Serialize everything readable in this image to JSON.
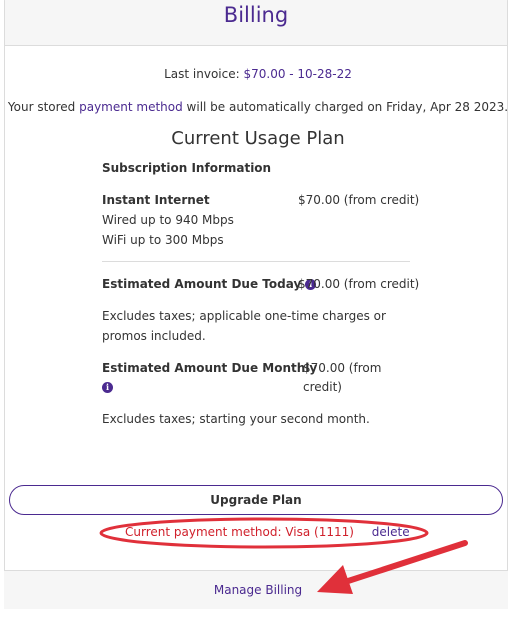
{
  "header": {
    "title": "Billing"
  },
  "invoice": {
    "label": "Last invoice: ",
    "link_text": "$70.00 - 10-28-22"
  },
  "autocharge": {
    "prefix": "Your stored ",
    "link_text": "payment method",
    "suffix": " will be automatically charged on Friday, Apr 28 2023."
  },
  "plan": {
    "title": "Current Usage Plan",
    "section_heading": "Subscription Information",
    "name": "Instant Internet",
    "price": "$70.00 (from credit)",
    "features": [
      "Wired up to 940 Mbps",
      "WiFi up to 300 Mbps"
    ],
    "today": {
      "label": "Estimated Amount Due Today",
      "price": "$70.00 (from credit)",
      "note_lines": [
        "Excludes taxes; applicable one-time charges or",
        "promos included."
      ]
    },
    "monthly": {
      "label": "Estimated Amount Due Monthly",
      "price_lines": [
        "$70.00 (from",
        "credit)"
      ],
      "note": "Excludes taxes; starting your second month."
    }
  },
  "actions": {
    "upgrade_label": "Upgrade Plan",
    "payment_method_text": "Current payment method: Visa (1111)",
    "delete_label": "delete",
    "manage_billing_label": "Manage Billing"
  },
  "icons": {
    "info": "info-icon",
    "arrow": "arrow-annotation",
    "ellipse": "ellipse-annotation"
  },
  "colors": {
    "brand": "#4b2a90",
    "annotation": "#e0303a",
    "header_bg": "#f6f6f6"
  }
}
